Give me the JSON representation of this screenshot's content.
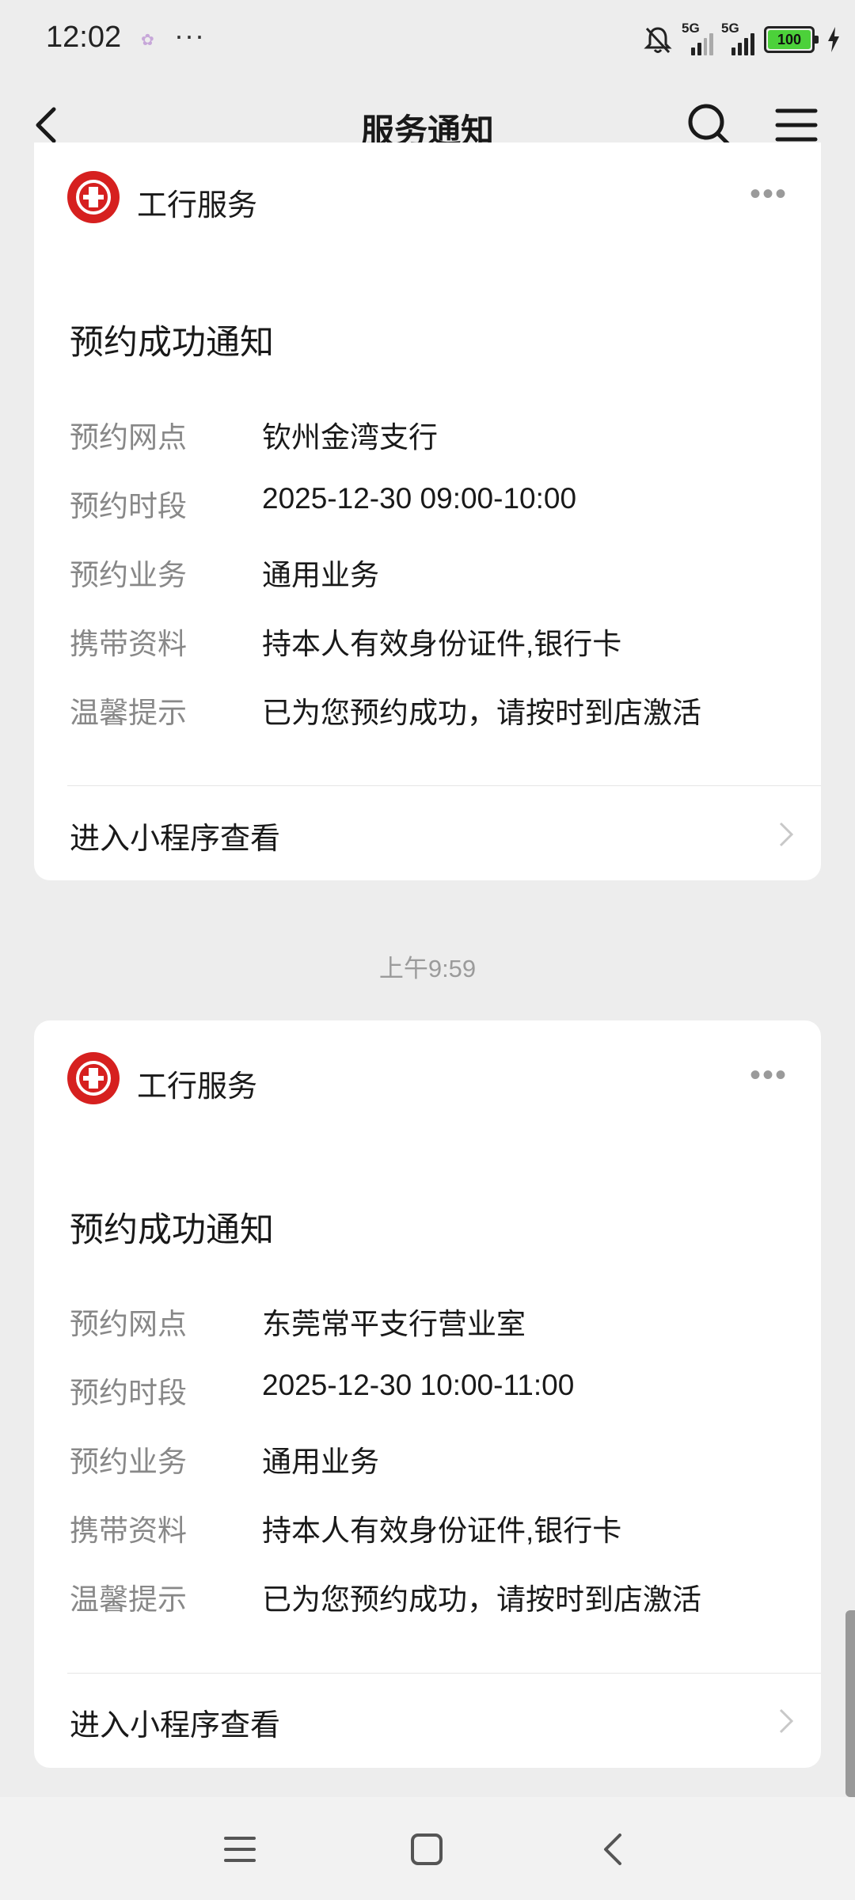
{
  "status": {
    "time": "12:02",
    "dots": "···",
    "sig1_label": "5G",
    "sig2_label": "5G",
    "battery": "100"
  },
  "nav": {
    "title": "服务通知"
  },
  "card1": {
    "service": "工行服务",
    "title": "预约成功通知",
    "rows": [
      {
        "k": "预约网点",
        "v": "钦州金湾支行"
      },
      {
        "k": "预约时段",
        "v": "2025-12-30 09:00-10:00"
      },
      {
        "k": "预约业务",
        "v": "通用业务"
      },
      {
        "k": "携带资料",
        "v": "持本人有效身份证件,银行卡"
      },
      {
        "k": "温馨提示",
        "v": "已为您预约成功，请按时到店激活"
      }
    ],
    "link": "进入小程序查看"
  },
  "timestamp": "上午9:59",
  "card2": {
    "service": "工行服务",
    "title": "预约成功通知",
    "rows": [
      {
        "k": "预约网点",
        "v": "东莞常平支行营业室"
      },
      {
        "k": "预约时段",
        "v": "2025-12-30 10:00-11:00"
      },
      {
        "k": "预约业务",
        "v": "通用业务"
      },
      {
        "k": "携带资料",
        "v": "持本人有效身份证件,银行卡"
      },
      {
        "k": "温馨提示",
        "v": "已为您预约成功，请按时到店激活"
      }
    ],
    "link": "进入小程序查看"
  },
  "colors": {
    "brand_red": "#d6201f",
    "background": "#ededed",
    "battery_green": "#4cd13a"
  },
  "icons": [
    "mute-bell-icon",
    "back-arrow-icon",
    "search-icon",
    "menu-icon",
    "icbc-logo-icon",
    "more-icon",
    "chevron-right-icon",
    "home-square-icon"
  ]
}
